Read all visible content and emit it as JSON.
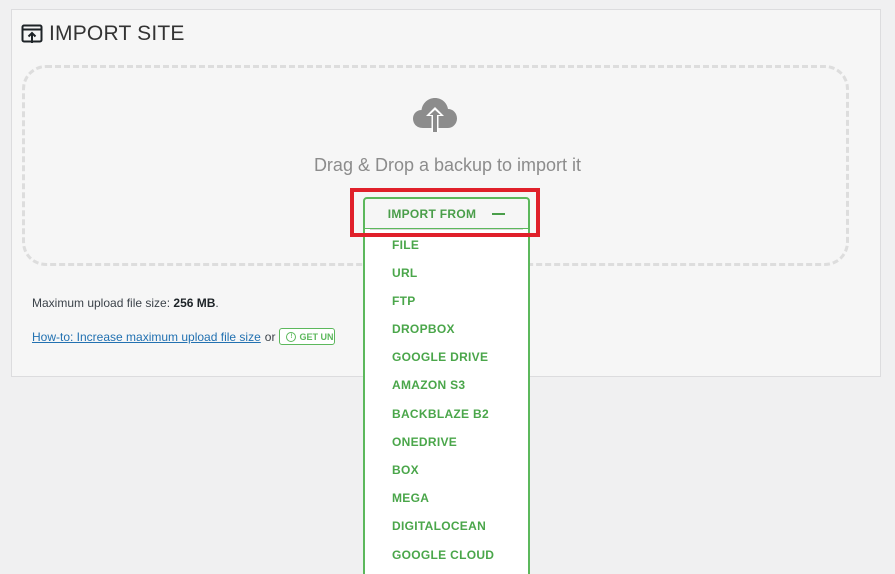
{
  "header": {
    "title": "IMPORT SITE"
  },
  "dropzone": {
    "drag_text": "Drag & Drop a backup to import it"
  },
  "import_from": {
    "label": "IMPORT FROM",
    "items": [
      {
        "label": "FILE"
      },
      {
        "label": "URL"
      },
      {
        "label": "FTP"
      },
      {
        "label": "DROPBOX"
      },
      {
        "label": "GOOGLE DRIVE"
      },
      {
        "label": "AMAZON S3"
      },
      {
        "label": "BACKBLAZE B2"
      },
      {
        "label": "ONEDRIVE"
      },
      {
        "label": "BOX"
      },
      {
        "label": "MEGA"
      },
      {
        "label": "DIGITALOCEAN"
      },
      {
        "label": "GOOGLE CLOUD"
      }
    ]
  },
  "upload_info": {
    "prefix": "Maximum upload file size: ",
    "size": "256 MB",
    "suffix": "."
  },
  "help": {
    "link_text": "How-to: Increase maximum upload file size",
    "or_text": "or",
    "unlimited_label": "GET UNLI"
  },
  "colors": {
    "accent_green": "#5cb85c",
    "highlight_red": "#e0202a",
    "link_blue": "#2271b1"
  },
  "icons": {
    "title": "import-site-icon",
    "cloud": "cloud-upload-icon",
    "toggle": "minus-icon",
    "info": "info-icon"
  }
}
